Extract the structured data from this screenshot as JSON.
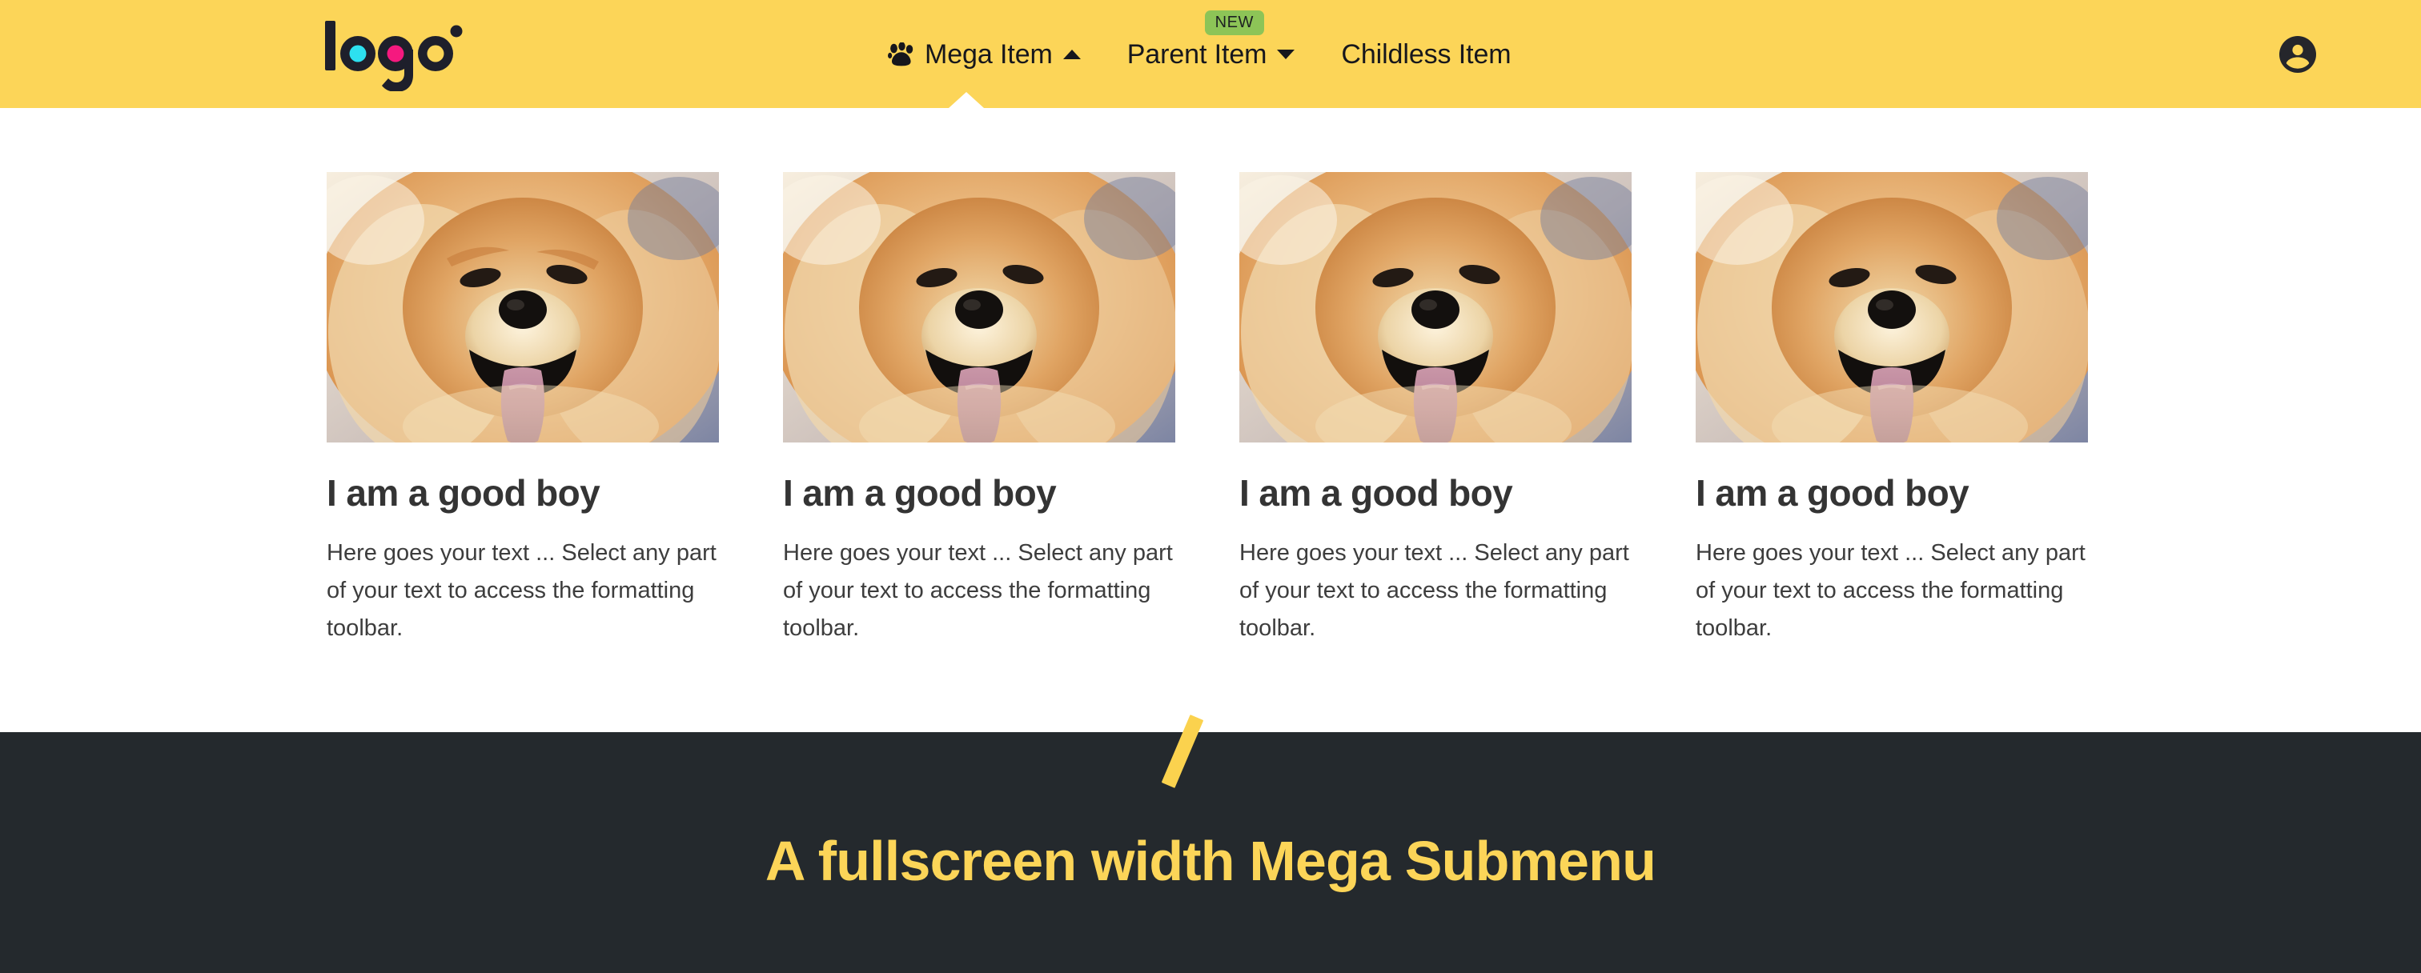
{
  "header": {
    "background_color": "#fcd558",
    "logo": {
      "text": "logo",
      "icon": "logo-wordmark",
      "colors": {
        "dark": "#1e1f2b",
        "cyan": "#2de0f0",
        "magenta": "#f5197f",
        "yellow": "#fcd558"
      }
    },
    "nav_items": [
      {
        "label": "Mega Item",
        "icon": "paw-icon",
        "caret": "chevron-up-icon",
        "badge": null,
        "expanded": true
      },
      {
        "label": "Parent Item",
        "icon": null,
        "caret": "chevron-down-icon",
        "badge": "NEW",
        "expanded": false
      },
      {
        "label": "Childless Item",
        "icon": null,
        "caret": null,
        "badge": null,
        "expanded": false
      }
    ],
    "account": {
      "icon": "account-circle-icon",
      "label": "Account"
    }
  },
  "mega_panel": {
    "cards": [
      {
        "image_alt": "chow-chow-dog-photo",
        "title": "I am a good boy",
        "body": "Here goes your text ... Select any part of your text to access the formatting toolbar."
      },
      {
        "image_alt": "chow-chow-dog-photo",
        "title": "I am a good boy",
        "body": "Here goes your text ... Select any part of your text to access the formatting toolbar."
      },
      {
        "image_alt": "chow-chow-dog-photo",
        "title": "I am a good boy",
        "body": "Here goes your text ... Select any part of your text to access the formatting toolbar."
      },
      {
        "image_alt": "chow-chow-dog-photo",
        "title": "I am a good boy",
        "body": "Here goes your text ... Select any part of your text to access the formatting toolbar."
      }
    ]
  },
  "dark_banner": {
    "title": "A fullscreen width Mega Submenu",
    "background_color": "#24292d",
    "text_color": "#fcd558",
    "decoration": "yellow-slash-mark"
  }
}
